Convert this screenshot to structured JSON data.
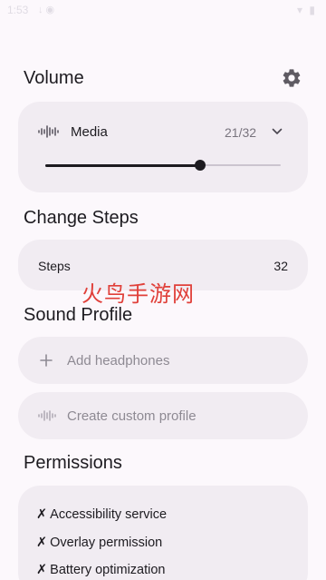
{
  "status_bar": {
    "time": "1:53",
    "left_icons": "↓ ◉",
    "right_icons": "▾ ▮"
  },
  "volume": {
    "title": "Volume",
    "settings_icon": "gear-icon",
    "media_icon": "waveform-icon",
    "media_label": "Media",
    "media_value": "21/32",
    "expand_icon": "chevron-down-icon",
    "slider_level": 0.657
  },
  "steps": {
    "title": "Change Steps",
    "label": "Steps",
    "value": "32"
  },
  "watermark": "火鸟手游网",
  "sound_profile": {
    "title": "Sound Profile",
    "add_label": "Add headphones",
    "add_icon": "plus-icon",
    "custom_label": "Create custom profile",
    "custom_icon": "waveform-icon"
  },
  "permissions": {
    "title": "Permissions",
    "items": [
      {
        "mark": "✗",
        "label": "Accessibility service"
      },
      {
        "mark": "✗",
        "label": "Overlay permission"
      },
      {
        "mark": "✗",
        "label": "Battery optimization"
      }
    ]
  },
  "colors": {
    "background": "#fcf8fc",
    "card": "#f1ecf2",
    "text": "#1d1b20",
    "muted": "#79747e",
    "watermark": "#e0403a"
  }
}
